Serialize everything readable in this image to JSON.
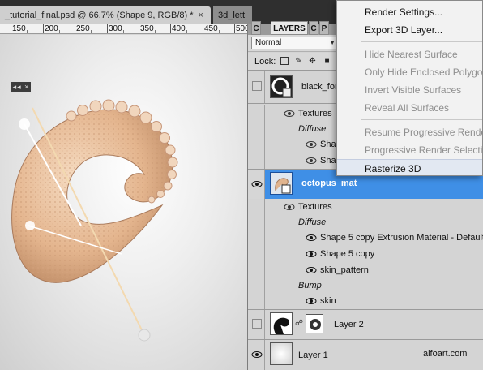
{
  "document_tabs": [
    {
      "label": "_tutorial_final.psd @ 66.7% (Shape 9, RGB/8) *",
      "close": "×"
    },
    {
      "label": "3d_lett"
    }
  ],
  "ruler": {
    "labels": [
      "150",
      "200",
      "250",
      "300",
      "350",
      "400",
      "450",
      "500"
    ]
  },
  "panel_controls": "◂◂ ×",
  "panel_tabs": [
    "C",
    "LAYERS",
    "C",
    "P"
  ],
  "layers_panel": {
    "blend_mode": "Normal",
    "lock_label": "Lock:",
    "rows": [
      {
        "label": "black_for_"
      },
      {
        "label": "Textures"
      },
      {
        "label": "Diffuse"
      },
      {
        "label": "Shap"
      },
      {
        "label": "Shap"
      },
      {
        "label": "octopus_mat"
      },
      {
        "label": "Textures"
      },
      {
        "label": "Diffuse"
      },
      {
        "label": "Shape 5 copy Extrusion Material - Default ..."
      },
      {
        "label": "Shape 5 copy"
      },
      {
        "label": "skin_pattern"
      },
      {
        "label": "Bump"
      },
      {
        "label": "skin"
      },
      {
        "label": "Layer 2"
      },
      {
        "label": "Layer 1"
      }
    ]
  },
  "context_menu": {
    "items": [
      {
        "label": "Render Settings...",
        "enabled": true
      },
      {
        "label": "Export 3D Layer...",
        "enabled": true
      },
      {
        "label": "Hide Nearest Surface",
        "enabled": false
      },
      {
        "label": "Only Hide Enclosed Polygons",
        "enabled": false
      },
      {
        "label": "Invert Visible Surfaces",
        "enabled": false
      },
      {
        "label": "Reveal All Surfaces",
        "enabled": false
      },
      {
        "label": "Resume Progressive Render",
        "enabled": false
      },
      {
        "label": "Progressive Render Selection",
        "enabled": false
      },
      {
        "label": "Rasterize 3D",
        "enabled": true,
        "hovered": true
      }
    ]
  },
  "watermark": "alfoart.com",
  "colors": {
    "selection": "#3f8fe6",
    "tab_bar": "#2f2f2f",
    "panel": "#d4d4d4"
  }
}
